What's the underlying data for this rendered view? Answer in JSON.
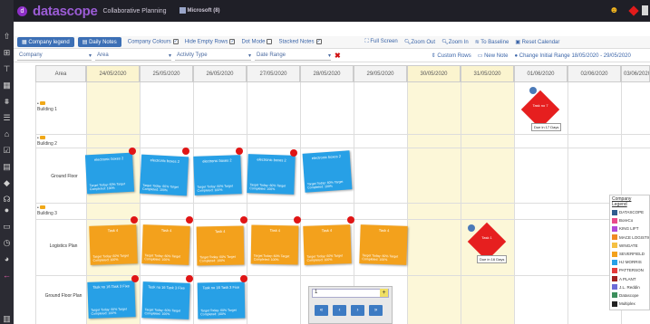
{
  "header": {
    "brand": "datascope",
    "app_title": "Collaborative Planning",
    "org": "Microsoft (8)"
  },
  "toolbar": {
    "company_legend": "Company legend",
    "daily_notes": "Daily Notes",
    "company_colours": "Company Colours",
    "hide_empty_rows": "Hide Empty Rows",
    "dot_mode": "Dot Mode",
    "stacked_notes": "Stacked Notes",
    "full_screen": "Full Screen",
    "zoom_out": "Zoom Out",
    "zoom_in": "Zoom In",
    "to_baseline": "To Baseline",
    "reset_calendar": "Reset Calendar",
    "custom_rows": "Custom Rows",
    "new_note": "New Note",
    "change_range": "Change Initial Range 18/05/2020 - 29/05/2020"
  },
  "filters": {
    "company": "Company",
    "area": "Area",
    "activity_type": "Activity Type",
    "date_range": "Date Range"
  },
  "grid": {
    "area_header": "Area",
    "dates": [
      "24/05/2020",
      "25/05/2020",
      "26/05/2020",
      "27/05/2020",
      "28/05/2020",
      "29/05/2020",
      "30/05/2020",
      "31/05/2020",
      "01/06/2020",
      "02/06/2020",
      "03/06/2020"
    ],
    "buildings": [
      "Building 1",
      "Building 2",
      "Building 3"
    ],
    "subrows": [
      "Ground Floor",
      "Logistics Plan",
      "Ground Floor Plan"
    ]
  },
  "notes": {
    "blue_title": "electronic boxes 2",
    "blue_foot": "Target Today: 60% Target Completed: 100%",
    "orange_title": "Task 4",
    "orange_foot": "Target Today: 60% Target Completed: 100%",
    "blue2_title": "Task no 16 Task 3 Fixe",
    "red_task1": "Task no 7",
    "red_task2": "Task 1",
    "due1": "Due in 17 Days",
    "due2": "Due in 16 Days"
  },
  "pager": {
    "page": "1",
    "first": "«",
    "prev": "‹",
    "next": "›",
    "last": "»",
    "add": "+"
  },
  "legend": {
    "title": "Company Legend",
    "items": [
      {
        "name": "DATASCOPE",
        "color": "#2f5c8f"
      },
      {
        "name": "BoreCo",
        "color": "#e84a8a"
      },
      {
        "name": "KING LIFT",
        "color": "#b04ad8"
      },
      {
        "name": "MACE LOGISTICS",
        "color": "#f08a24"
      },
      {
        "name": "WINGATE",
        "color": "#f5c043"
      },
      {
        "name": "SEVERFIELD",
        "color": "#f3a11c"
      },
      {
        "name": "HJ MORRIS",
        "color": "#27a0e6"
      },
      {
        "name": "PATTERSON",
        "color": "#e53a3a"
      },
      {
        "name": "A PLANT",
        "color": "#a02020"
      },
      {
        "name": "J.L. Reddin",
        "color": "#6b6bd8"
      },
      {
        "name": "Datascope",
        "color": "#3c8f5c"
      },
      {
        "name": "Multiplex",
        "color": "#222222"
      }
    ]
  }
}
